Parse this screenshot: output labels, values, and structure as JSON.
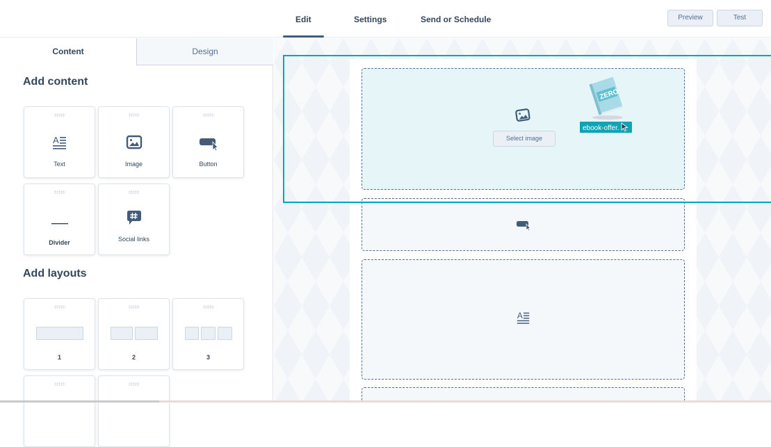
{
  "header": {
    "tabs": [
      {
        "label": "Edit",
        "active": true
      },
      {
        "label": "Settings",
        "active": false
      },
      {
        "label": "Send or Schedule",
        "active": false
      }
    ],
    "buttons": {
      "preview": "Preview",
      "test": "Test"
    }
  },
  "sidebar": {
    "tabs": [
      {
        "label": "Content",
        "active": true
      },
      {
        "label": "Design",
        "active": false
      }
    ],
    "add_content_title": "Add content",
    "content_items": [
      {
        "label": "Text",
        "icon": "text-icon"
      },
      {
        "label": "Image",
        "icon": "image-icon"
      },
      {
        "label": "Button",
        "icon": "button-icon"
      },
      {
        "label": "Divider",
        "icon": "divider-icon"
      },
      {
        "label": "Social links",
        "icon": "social-hashtag-icon"
      }
    ],
    "add_layouts_title": "Add layouts",
    "layouts": [
      {
        "label": "1",
        "columns": 1
      },
      {
        "label": "2",
        "columns": 2
      },
      {
        "label": "3",
        "columns": 3
      }
    ]
  },
  "canvas": {
    "image_module": {
      "button_label": "Select image"
    },
    "drag_ghost": {
      "file_label": "ebook-offer.",
      "book_title": "ZERO"
    },
    "colors": {
      "accent": "#00a4bd",
      "drop_active": "#e5f5f8",
      "icon": "#425b76"
    }
  }
}
